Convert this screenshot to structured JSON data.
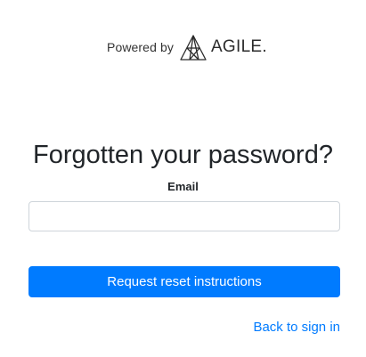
{
  "branding": {
    "powered_by": "Powered by",
    "logo_text": "AGILE."
  },
  "form": {
    "title": "Forgotten your password?",
    "email_label": "Email",
    "email_value": "",
    "email_placeholder": "",
    "submit_label": "Request reset instructions"
  },
  "links": {
    "back_to_sign_in": "Back to sign in"
  },
  "colors": {
    "primary": "#007bff",
    "text": "#212529",
    "input_border": "#ced4da"
  }
}
